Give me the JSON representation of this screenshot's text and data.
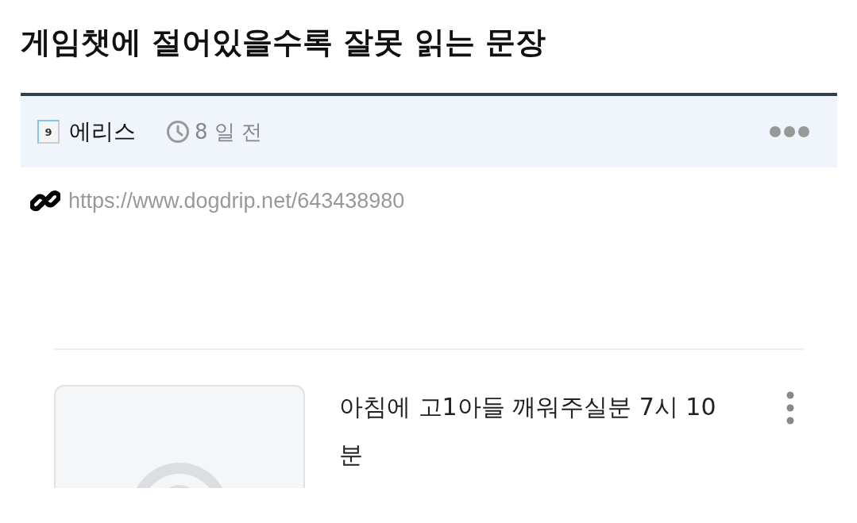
{
  "post": {
    "title": "게임챗에 절어있을수록 잘못 읽는 문장",
    "author": {
      "level": "9",
      "name": "에리스"
    },
    "time": "8 일 전",
    "link": "https://www.dogdrip.net/643438980"
  },
  "related": [
    {
      "title": "아침에 고1아들 깨워주실분 7시 10분"
    }
  ]
}
